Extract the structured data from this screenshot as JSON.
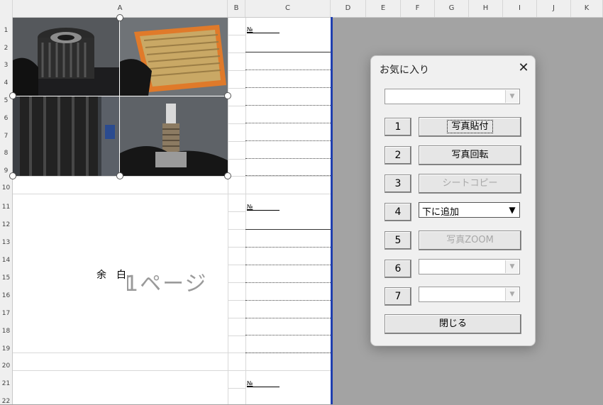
{
  "columns": [
    "A",
    "B",
    "C",
    "D",
    "E",
    "F",
    "G",
    "H",
    "I",
    "J",
    "K"
  ],
  "rows": [
    "1",
    "2",
    "3",
    "4",
    "5",
    "6",
    "7",
    "8",
    "9",
    "10",
    "11",
    "12",
    "13",
    "14",
    "15",
    "16",
    "17",
    "18",
    "19",
    "20",
    "21",
    "22"
  ],
  "sheet": {
    "no_label": "№",
    "margin_label": "余　白",
    "page_label": "1ページ",
    "photos": [
      {
        "subject": "oil-filter-photo",
        "color": "#4b4b4b"
      },
      {
        "subject": "air-filter-photo",
        "color": "#c9a15a"
      },
      {
        "subject": "tire-photo",
        "color": "#2e2e2e"
      },
      {
        "subject": "spark-plug-photo",
        "color": "#6b6b6b"
      }
    ]
  },
  "dialog": {
    "title": "お気に入り",
    "close_glyph": "✕",
    "top_combo_value": "",
    "numbers": [
      "1",
      "2",
      "3",
      "4",
      "5",
      "6",
      "7"
    ],
    "buttons": {
      "paste_photo": "写真貼付",
      "rotate_photo": "写真回転",
      "sheet_copy": "シートコピー",
      "add_below": "下に追加",
      "photo_zoom": "写真ZOOM",
      "close": "閉じる"
    },
    "combo6_value": "",
    "combo7_value": ""
  }
}
